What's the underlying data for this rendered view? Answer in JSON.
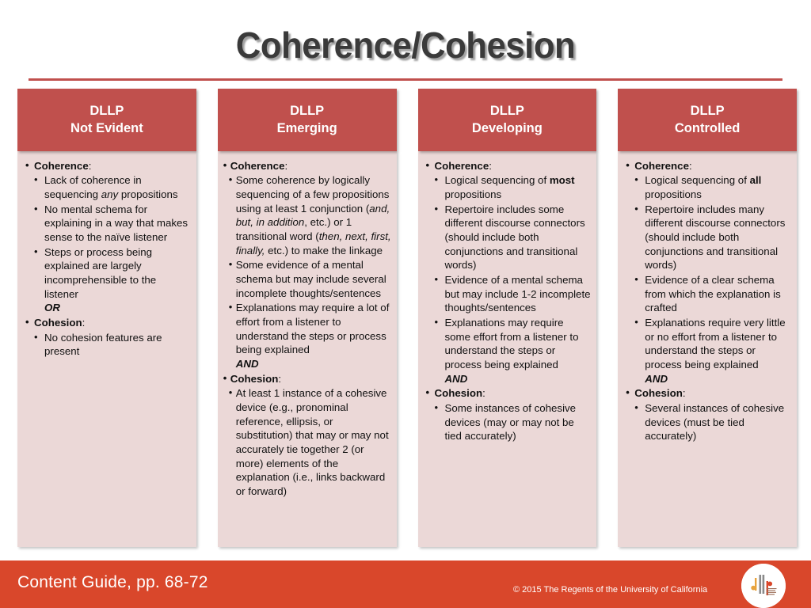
{
  "slide": {
    "title": "Coherence/Cohesion",
    "accent_color": "#C0504D",
    "panel_color": "#EBD8D7",
    "footer_color": "#D9472B"
  },
  "columns": [
    {
      "header_line1": "DLLP",
      "header_line2": "Not Evident",
      "tight": false,
      "sections": [
        {
          "label": "Coherence",
          "items": [
            [
              {
                "t": "Lack of coherence in sequencing "
              },
              {
                "t": "any",
                "style": "i"
              },
              {
                "t": " propositions"
              }
            ],
            [
              {
                "t": "No mental schema for explaining in a way that makes sense to the naïve listener"
              }
            ],
            [
              {
                "t": "Steps or process being explained are largely incomprehensible to the listener"
              },
              {
                "t": "OR",
                "style": "bi",
                "break": true
              }
            ]
          ]
        },
        {
          "label": "Cohesion",
          "items": [
            [
              {
                "t": "No cohesion features are present"
              }
            ]
          ]
        }
      ]
    },
    {
      "header_line1": "DLLP",
      "header_line2": "Emerging",
      "tight": true,
      "sections": [
        {
          "label": "Coherence",
          "items": [
            [
              {
                "t": "Some coherence by logically sequencing of a few propositions using at least 1 conjunction ("
              },
              {
                "t": "and, but, in addition",
                "style": "i"
              },
              {
                "t": ", etc.) or 1 transitional word ("
              },
              {
                "t": "then, next, first, finally,",
                "style": "i"
              },
              {
                "t": " etc.) to make the linkage"
              }
            ],
            [
              {
                "t": "Some evidence of a mental schema but may include several incomplete thoughts/sentences"
              }
            ],
            [
              {
                "t": "Explanations may require a lot of effort from a listener to understand the steps or process being explained"
              },
              {
                "t": "AND",
                "style": "bi",
                "break": true
              }
            ]
          ]
        },
        {
          "label": "Cohesion",
          "items": [
            [
              {
                "t": "At least 1 instance of a cohesive device (e.g., pronominal reference, ellipsis, or substitution) that may or may not accurately tie together 2 (or more) elements of the explanation (i.e., links backward or forward)"
              }
            ]
          ]
        }
      ]
    },
    {
      "header_line1": "DLLP",
      "header_line2": "Developing",
      "tight": false,
      "sections": [
        {
          "label": "Coherence",
          "items": [
            [
              {
                "t": "Logical sequencing of "
              },
              {
                "t": "most",
                "style": "bd"
              },
              {
                "t": " propositions"
              }
            ],
            [
              {
                "t": "Repertoire includes some different discourse connectors (should include both conjunctions and transitional words)"
              }
            ],
            [
              {
                "t": "Evidence of a mental schema but may include 1-2 incomplete thoughts/sentences"
              }
            ],
            [
              {
                "t": "Explanations may require some effort from a listener to understand the steps or process being explained"
              },
              {
                "t": "AND",
                "style": "bi",
                "break": true
              }
            ]
          ]
        },
        {
          "label": "Cohesion",
          "items": [
            [
              {
                "t": "Some instances of cohesive devices (may or may not be tied accurately)"
              }
            ]
          ]
        }
      ]
    },
    {
      "header_line1": "DLLP",
      "header_line2": "Controlled",
      "tight": false,
      "sections": [
        {
          "label": "Coherence",
          "items": [
            [
              {
                "t": "Logical sequencing of "
              },
              {
                "t": "all",
                "style": "bd"
              },
              {
                "t": " propositions"
              }
            ],
            [
              {
                "t": "Repertoire includes many different discourse connectors (should include both conjunctions and transitional words)"
              }
            ],
            [
              {
                "t": "Evidence of a clear schema from which the explanation is crafted"
              }
            ],
            [
              {
                "t": "Explanations require very little or no effort from a listener to understand the steps or process being explained"
              },
              {
                "t": "AND",
                "style": "bi",
                "break": true
              }
            ]
          ]
        },
        {
          "label": "Cohesion",
          "items": [
            [
              {
                "t": "Several instances of cohesive devices (must be tied accurately)"
              }
            ]
          ]
        }
      ]
    }
  ],
  "footer": {
    "title": "Content Guide, pp. 68-72",
    "copyright": "© 2015 The Regents of the University of California",
    "logo_name": "dllp-logo"
  }
}
